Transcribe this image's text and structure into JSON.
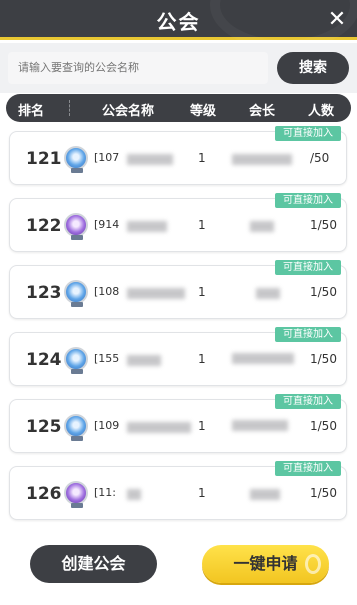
{
  "title": "公会",
  "close_label": "✕",
  "search": {
    "placeholder": "请输入要查询的公会名称",
    "button_label": "搜索"
  },
  "columns": {
    "rank": "排名",
    "name": "公会名称",
    "level": "等级",
    "leader": "会长",
    "members": "人数"
  },
  "badge_label": "可直接加入",
  "guilds": [
    {
      "rank": "121",
      "name_prefix": "[107",
      "level": "1",
      "members": "/50",
      "emblem": "blue-emblem-icon"
    },
    {
      "rank": "122",
      "name_prefix": "[914",
      "level": "1",
      "members": "1/50",
      "emblem": "purple-emblem-icon"
    },
    {
      "rank": "123",
      "name_prefix": "[108",
      "level": "1",
      "members": "1/50",
      "emblem": "blue-emblem-icon"
    },
    {
      "rank": "124",
      "name_prefix": "[155",
      "level": "1",
      "members": "1/50",
      "emblem": "blue-emblem-icon"
    },
    {
      "rank": "125",
      "name_prefix": "[109",
      "level": "1",
      "members": "1/50",
      "emblem": "blue-emblem-icon"
    },
    {
      "rank": "126",
      "name_prefix": "[11:",
      "level": "1",
      "members": "1/50",
      "emblem": "purple-emblem-icon"
    }
  ],
  "footer": {
    "create_label": "创建公会",
    "apply_label": "一键申请"
  },
  "colors": {
    "dark": "#3d3f44",
    "accent_yellow": "#f2c521",
    "badge_green": "#5cc6a2"
  }
}
